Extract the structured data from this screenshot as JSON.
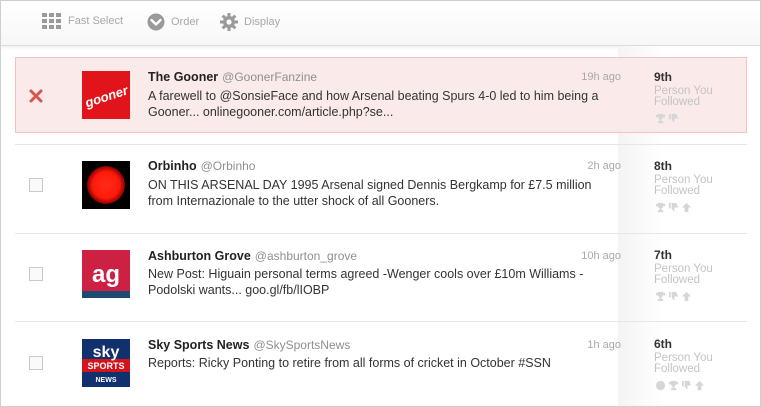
{
  "toolbar": {
    "fast_select": "Fast Select",
    "order": "Order",
    "display": "Display"
  },
  "rows": [
    {
      "name": "The Gooner",
      "handle": "@GoonerFanzine",
      "time": "19h ago",
      "text": "A farewell to @SonsieFace and how Arsenal beating Spurs 4-0 led to him being a Gooner... onlinegooner.com/article.php?se...",
      "rank": "9th",
      "rank_label": "Person You Followed",
      "avatar_text": "gooner",
      "state": "removed"
    },
    {
      "name": "Orbinho",
      "handle": "@Orbinho",
      "time": "2h ago",
      "text": "ON THIS ARSENAL DAY 1995 Arsenal signed Dennis Bergkamp for £7.5 million from Internazionale to the utter shock of all Gooners.",
      "rank": "8th",
      "rank_label": "Person You Followed",
      "state": "unchecked"
    },
    {
      "name": "Ashburton Grove",
      "handle": "@ashburton_grove",
      "time": "10h ago",
      "text": "New Post: Higuain personal terms agreed -Wenger cools over £10m Williams -Podolski wants... goo.gl/fb/lIOBP",
      "rank": "7th",
      "rank_label": "Person You Followed",
      "avatar_text": "ag",
      "state": "unchecked"
    },
    {
      "name": "Sky Sports News",
      "handle": "@SkySportsNews",
      "time": "1h ago",
      "text": "Reports: Ricky Ponting to retire from all forms of cricket in October #SSN",
      "rank": "6th",
      "rank_label": "Person You Followed",
      "avatar_text": [
        "sky",
        "SPORTS",
        "NEWS"
      ],
      "state": "unchecked"
    }
  ],
  "colors": {
    "selected_row_bg": "#fbeaea",
    "remove_x": "#d9534f",
    "gooner_red": "#e1141b",
    "ag_red": "#cc2143",
    "sky_blue": "#10306e"
  }
}
